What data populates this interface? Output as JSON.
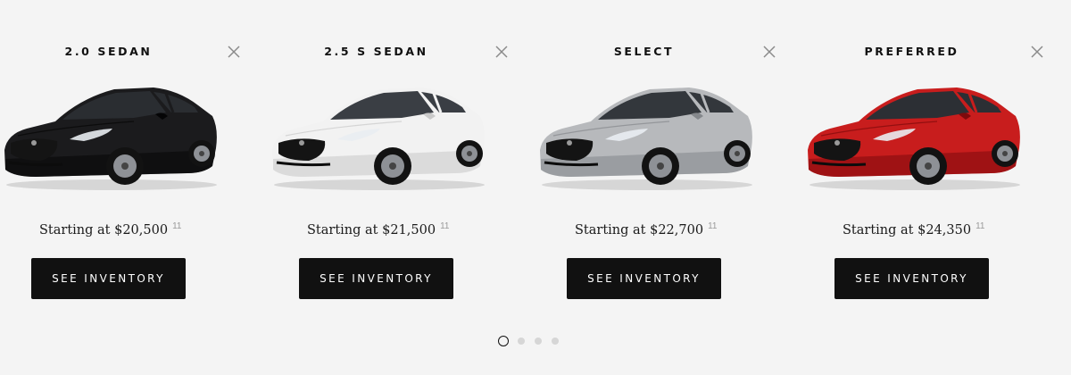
{
  "trims": [
    {
      "name": "2.0 SEDAN",
      "price_text": "Starting at $20,500",
      "footnote": "11",
      "button_label": "SEE INVENTORY",
      "car_color": "#1b1b1d",
      "car_shade": "#050506",
      "car_glass": "#2a2d31"
    },
    {
      "name": "2.5 S SEDAN",
      "price_text": "Starting at $21,500",
      "footnote": "11",
      "button_label": "SEE INVENTORY",
      "car_color": "#f2f2f2",
      "car_shade": "#c9c9c9",
      "car_glass": "#3a3e44"
    },
    {
      "name": "SELECT",
      "price_text": "Starting at $22,700",
      "footnote": "11",
      "button_label": "SEE INVENTORY",
      "car_color": "#b7b9bc",
      "car_shade": "#84878b",
      "car_glass": "#33373c"
    },
    {
      "name": "PREFERRED",
      "price_text": "Starting at $24,350",
      "footnote": "11",
      "button_label": "SEE INVENTORY",
      "car_color": "#c81d1d",
      "car_shade": "#7d0a0c",
      "car_glass": "#2c2f34"
    }
  ],
  "pagination": {
    "total_pages": 4,
    "active_page": 1
  },
  "colors": {
    "page_background": "#f4f4f4",
    "button_background": "#111111",
    "button_text": "#ffffff",
    "close_icon": "#8a8a8a",
    "footnote": "#9a9a9a",
    "dot_inactive": "#d6d6d6"
  },
  "icons": {
    "close": "close-icon"
  }
}
